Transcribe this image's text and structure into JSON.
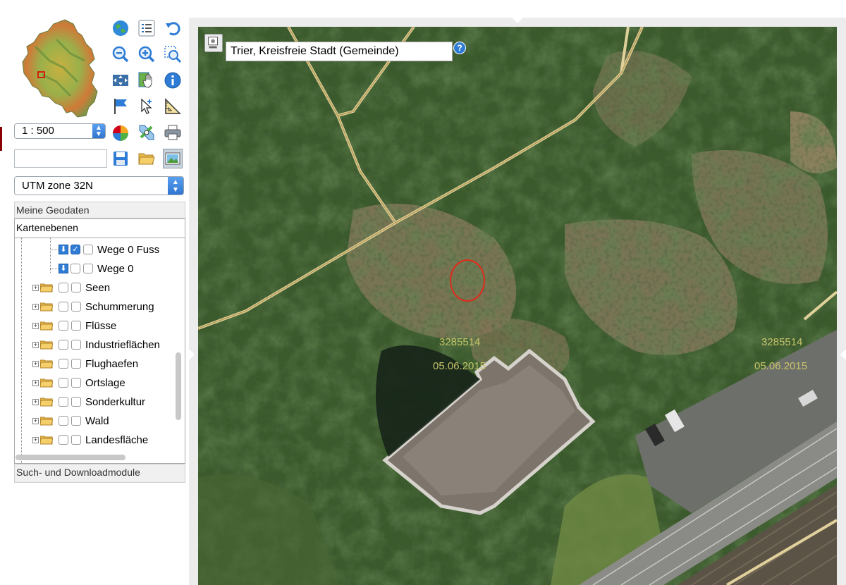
{
  "toolbar": {
    "tools": [
      "globe-icon",
      "list-icon",
      "undo-icon",
      "zoom-out-icon",
      "zoom-in-icon",
      "zoom-box-icon",
      "pan-icon",
      "hand-select-icon",
      "info-icon",
      "flag-icon",
      "select-arrow-icon",
      "measure-icon",
      "color-palette-icon",
      "satellite-icon",
      "print-icon",
      "save-icon",
      "folder-open-icon",
      "image-icon"
    ]
  },
  "scale_select": {
    "value": "1 : 500"
  },
  "name_input": {
    "value": ""
  },
  "crs_select": {
    "value": "UTM zone 32N"
  },
  "panels": {
    "meine_geodaten": "Meine Geodaten",
    "kartenebenen": "Kartenebenen",
    "such_download": "Such- und Downloadmodule"
  },
  "layers": [
    {
      "label": "Wege 0 Fuss",
      "checked": true
    },
    {
      "label": "Wege 0",
      "checked": false
    },
    {
      "label": "Seen",
      "checked": false
    },
    {
      "label": "Schummerung",
      "checked": false
    },
    {
      "label": "Flüsse",
      "checked": false
    },
    {
      "label": "Industrieflächen",
      "checked": false
    },
    {
      "label": "Flughaefen",
      "checked": false
    },
    {
      "label": "Ortslage",
      "checked": false
    },
    {
      "label": "Sonderkultur",
      "checked": false
    },
    {
      "label": "Wald",
      "checked": false
    },
    {
      "label": "Landesfläche",
      "checked": false
    }
  ],
  "map": {
    "search_value": "Trier, Kreisfreie Stadt (Gemeinde)",
    "help_label": "?",
    "coords": [
      {
        "number": "3285514",
        "date": "05.06.2015"
      },
      {
        "number": "3285514",
        "date": "05.06.2015"
      }
    ]
  },
  "colors": {
    "accent": "#2e7cd6",
    "marker": "#e02a1a",
    "watermark": "#c7c46a"
  }
}
